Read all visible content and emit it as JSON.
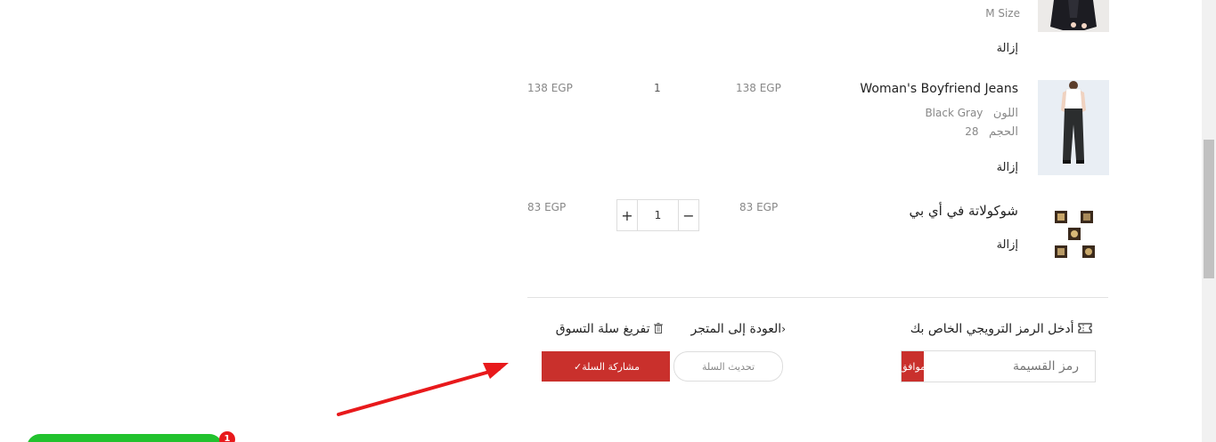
{
  "cart": {
    "items": [
      {
        "size_partial": "M  Size",
        "remove_label": "إزالة"
      },
      {
        "name": "Woman's Boyfriend Jeans",
        "color_label": "اللون",
        "color_value": "Black Gray",
        "size_label": "الحجم",
        "size_value": "28",
        "unit_price": "138 EGP",
        "quantity": "1",
        "total": "138 EGP",
        "remove_label": "إزالة"
      },
      {
        "name": "شوكولاتة في أي بي",
        "unit_price": "83 EGP",
        "quantity": "1",
        "total": "83 EGP",
        "remove_label": "إزالة",
        "plus": "+",
        "minus": "−"
      }
    ]
  },
  "coupon": {
    "title": "أدخل الرمز الترويجي الخاص بك",
    "placeholder": "رمز القسيمة",
    "apply_label": "موافق"
  },
  "actions": {
    "back_to_store": "العودة إلى المتجر",
    "clear_cart": "تفريغ سلة التسوق",
    "update_cart": "تحديث السلة",
    "share_cart": "مشاركة السلة"
  },
  "chat_widget": {
    "badge_count": "1"
  },
  "colors": {
    "accent_red": "#c9302c",
    "annotation_arrow": "#e8191b",
    "chat_green": "#22c22e"
  }
}
